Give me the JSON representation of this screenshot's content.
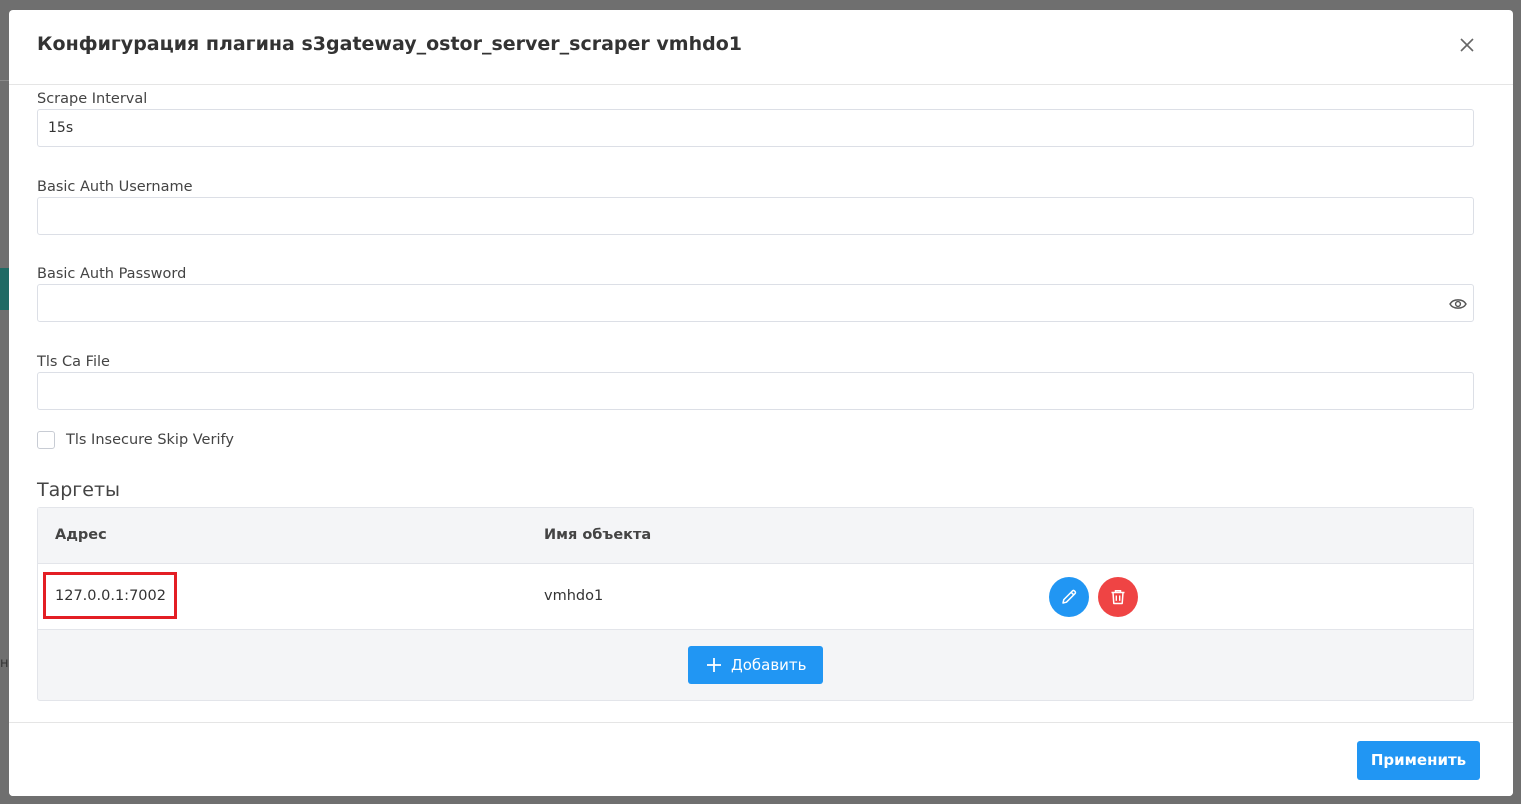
{
  "background": {
    "fragment_text": "на"
  },
  "modal": {
    "title": "Конфигурация плагина s3gateway_ostor_server_scraper vmhdo1",
    "fields": [
      {
        "label": "Scrape Interval",
        "value": "15s"
      },
      {
        "label": "Basic Auth Username",
        "value": ""
      },
      {
        "label": "Basic Auth Password",
        "value": ""
      },
      {
        "label": "Tls Ca File",
        "value": ""
      }
    ],
    "checkbox": {
      "label": "Tls Insecure Skip Verify",
      "checked": false
    },
    "targets": {
      "title": "Таргеты",
      "columns": [
        "Адрес",
        "Имя объекта"
      ],
      "rows": [
        {
          "address": "127.0.0.1:7002",
          "object_name": "vmhdo1"
        }
      ],
      "add_label": "Добавить"
    },
    "footer": {
      "apply_label": "Применить"
    }
  },
  "colors": {
    "accent": "#2196f3",
    "danger": "#ef4444",
    "highlight": "#e31e24",
    "overlay": "#6f6f6f"
  }
}
